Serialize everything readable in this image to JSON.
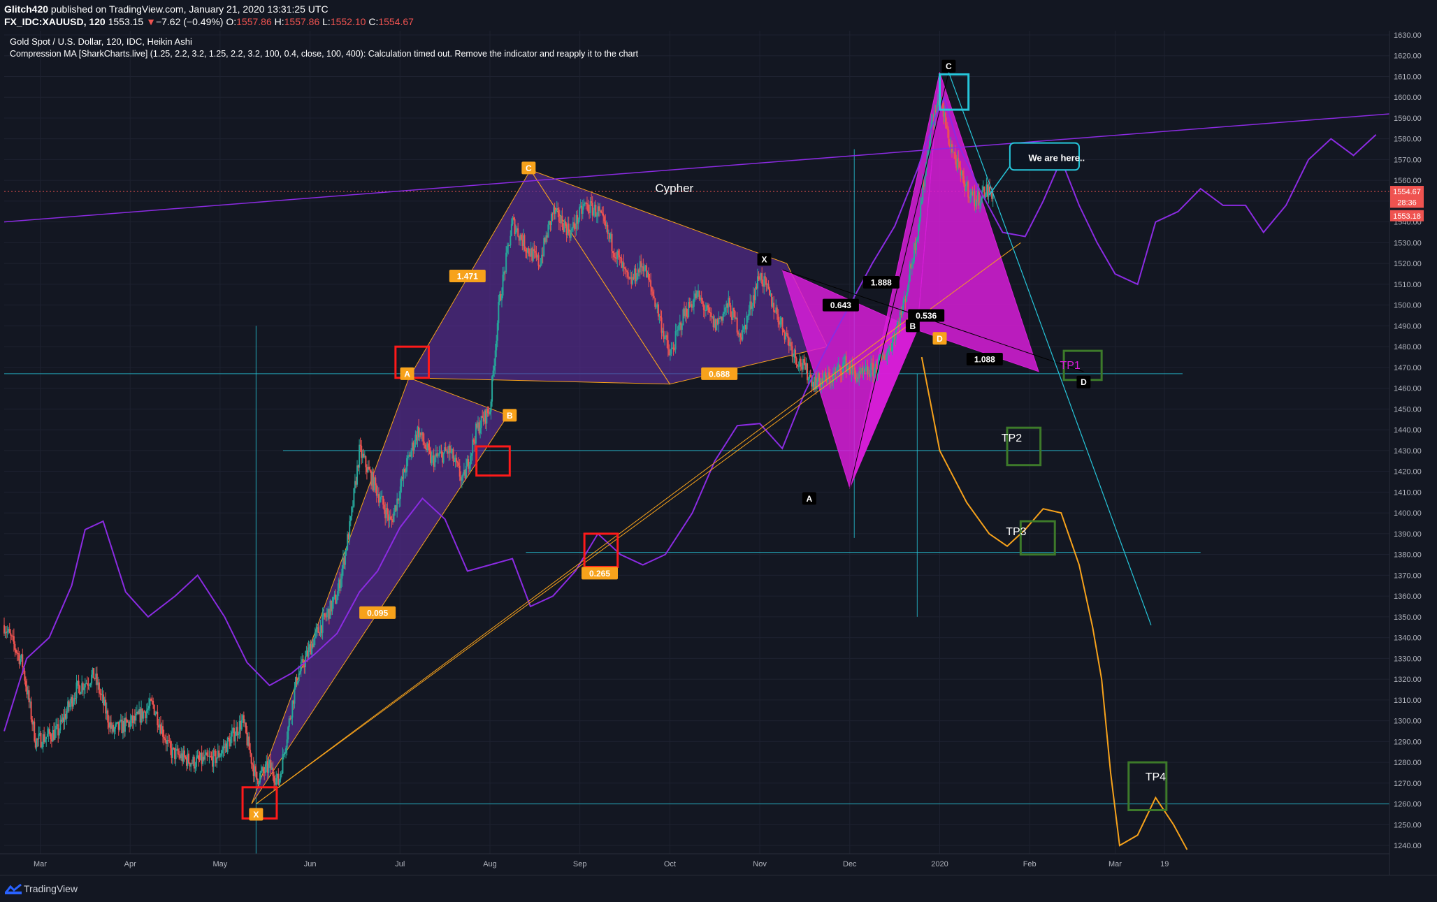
{
  "header": {
    "author": "Glitch420",
    "published": " published on TradingView.com, January 21, 2020 13:31:25 UTC",
    "symbol": "FX_IDC:XAUUSD, 120",
    "last": "1553.15",
    "arrow": "▼",
    "change": "−7.62 (−0.49%)",
    "o_label": "O:",
    "o": "1557.86",
    "h_label": "H:",
    "h": "1557.86",
    "l_label": "L:",
    "l": "1552.10",
    "c_label": "C:",
    "c": "1554.67"
  },
  "legend": {
    "title": "Gold Spot / U.S. Dollar, 120, IDC, Heikin Ashi",
    "indicator": "Compression MA [SharkCharts.live] (1.25, 2.2, 3.2, 1.25, 2.2, 3.2, 100, 0.4, close, 100, 400): Calculation timed out. Remove the indicator and reapply it to the chart"
  },
  "colors": {
    "background": "#131722",
    "grid": "#1e2230",
    "candle_up": "#26a69a",
    "candle_down": "#ef5350",
    "purple": "#8b2be2",
    "orange": "#f7a21b",
    "magenta": "#d81dd8",
    "cyan": "#26c6da",
    "red_box": "#ff1a1a",
    "green_box": "#3d7a2a"
  },
  "footer": {
    "brand": "TradingView"
  },
  "chart_data": {
    "type": "candlestick",
    "y_ticks": [
      1240,
      1250,
      1260,
      1270,
      1280,
      1290,
      1300,
      1310,
      1320,
      1330,
      1340,
      1350,
      1360,
      1370,
      1380,
      1390,
      1400,
      1410,
      1420,
      1430,
      1440,
      1450,
      1460,
      1470,
      1480,
      1490,
      1500,
      1510,
      1520,
      1530,
      1540,
      1550,
      1560,
      1570,
      1580,
      1590,
      1600,
      1610,
      1620,
      1630
    ],
    "ylim": [
      1236,
      1632
    ],
    "x_labels": [
      {
        "label": "Mar",
        "t": 0.5
      },
      {
        "label": "Apr",
        "t": 1.5
      },
      {
        "label": "May",
        "t": 2.5
      },
      {
        "label": "Jun",
        "t": 3.5
      },
      {
        "label": "Jul",
        "t": 4.5
      },
      {
        "label": "Aug",
        "t": 5.5
      },
      {
        "label": "Sep",
        "t": 6.5
      },
      {
        "label": "Oct",
        "t": 7.5
      },
      {
        "label": "Nov",
        "t": 8.5
      },
      {
        "label": "Dec",
        "t": 9.5
      },
      {
        "label": "2020",
        "t": 10.5
      },
      {
        "label": "Feb",
        "t": 11.5
      },
      {
        "label": "Mar",
        "t": 12.45
      },
      {
        "label": "19",
        "t": 13.0
      }
    ],
    "xlim": [
      0.1,
      15.5
    ],
    "price_labels": [
      {
        "value": 1554.67,
        "text": "1554.67",
        "color": "#ef5350"
      },
      {
        "value": 1549.5,
        "text": "28:36",
        "color": "#ef5350"
      },
      {
        "value": 1543.0,
        "text": "1553.18",
        "color": "#ef5350"
      }
    ],
    "current_price": 1554.67,
    "price_path": [
      [
        0.1,
        1346
      ],
      [
        0.3,
        1328
      ],
      [
        0.45,
        1290
      ],
      [
        0.7,
        1295
      ],
      [
        0.9,
        1315
      ],
      [
        1.1,
        1322
      ],
      [
        1.3,
        1295
      ],
      [
        1.55,
        1300
      ],
      [
        1.75,
        1308
      ],
      [
        1.95,
        1285
      ],
      [
        2.2,
        1280
      ],
      [
        2.45,
        1282
      ],
      [
        2.6,
        1290
      ],
      [
        2.75,
        1300
      ],
      [
        2.9,
        1272
      ],
      [
        3.05,
        1278
      ],
      [
        3.15,
        1270
      ],
      [
        3.35,
        1320
      ],
      [
        3.55,
        1340
      ],
      [
        3.8,
        1360
      ],
      [
        3.95,
        1395
      ],
      [
        4.05,
        1430
      ],
      [
        4.25,
        1410
      ],
      [
        4.4,
        1395
      ],
      [
        4.55,
        1420
      ],
      [
        4.7,
        1440
      ],
      [
        4.85,
        1425
      ],
      [
        5.05,
        1430
      ],
      [
        5.2,
        1415
      ],
      [
        5.35,
        1440
      ],
      [
        5.5,
        1450
      ],
      [
        5.6,
        1500
      ],
      [
        5.75,
        1540
      ],
      [
        5.9,
        1528
      ],
      [
        6.05,
        1520
      ],
      [
        6.2,
        1545
      ],
      [
        6.4,
        1535
      ],
      [
        6.55,
        1548
      ],
      [
        6.7,
        1545
      ],
      [
        6.85,
        1530
      ],
      [
        7.05,
        1510
      ],
      [
        7.2,
        1520
      ],
      [
        7.35,
        1500
      ],
      [
        7.5,
        1475
      ],
      [
        7.65,
        1495
      ],
      [
        7.8,
        1505
      ],
      [
        8.0,
        1490
      ],
      [
        8.15,
        1500
      ],
      [
        8.3,
        1485
      ],
      [
        8.5,
        1515
      ],
      [
        8.6,
        1505
      ],
      [
        8.75,
        1490
      ],
      [
        8.9,
        1475
      ],
      [
        9.1,
        1463
      ],
      [
        9.3,
        1465
      ],
      [
        9.45,
        1472
      ],
      [
        9.6,
        1465
      ],
      [
        9.8,
        1470
      ],
      [
        9.95,
        1480
      ],
      [
        10.1,
        1500
      ],
      [
        10.25,
        1535
      ],
      [
        10.4,
        1585
      ],
      [
        10.5,
        1600
      ],
      [
        10.6,
        1580
      ],
      [
        10.75,
        1560
      ],
      [
        10.9,
        1550
      ],
      [
        11.0,
        1555
      ],
      [
        11.1,
        1554
      ]
    ],
    "series": [
      {
        "name": "",
        "type": "line",
        "color": "#8b2be2",
        "points": [
          [
            0.1,
            1295
          ],
          [
            0.35,
            1330
          ],
          [
            0.6,
            1340
          ],
          [
            0.85,
            1365
          ],
          [
            1.0,
            1392
          ],
          [
            1.2,
            1396
          ],
          [
            1.45,
            1362
          ],
          [
            1.7,
            1350
          ],
          [
            2.0,
            1360
          ],
          [
            2.25,
            1370
          ],
          [
            2.55,
            1350
          ],
          [
            2.8,
            1328
          ],
          [
            3.05,
            1317
          ],
          [
            3.3,
            1323
          ],
          [
            3.55,
            1332
          ],
          [
            3.8,
            1342
          ],
          [
            4.05,
            1362
          ],
          [
            4.25,
            1372
          ],
          [
            4.5,
            1393
          ],
          [
            4.75,
            1407
          ],
          [
            5.0,
            1397
          ],
          [
            5.25,
            1372
          ],
          [
            5.5,
            1375
          ],
          [
            5.75,
            1378
          ],
          [
            5.95,
            1355
          ],
          [
            6.2,
            1360
          ],
          [
            6.45,
            1372
          ],
          [
            6.7,
            1390
          ],
          [
            6.95,
            1380
          ],
          [
            7.2,
            1375
          ],
          [
            7.45,
            1380
          ],
          [
            7.75,
            1400
          ],
          [
            8.0,
            1425
          ],
          [
            8.25,
            1442
          ],
          [
            8.5,
            1443
          ],
          [
            8.75,
            1431
          ],
          [
            9.0,
            1458
          ],
          [
            9.25,
            1480
          ],
          [
            9.5,
            1500
          ],
          [
            9.75,
            1520
          ],
          [
            10.0,
            1538
          ],
          [
            10.25,
            1565
          ],
          [
            10.45,
            1590
          ],
          [
            10.55,
            1600
          ],
          [
            10.7,
            1578
          ],
          [
            10.95,
            1555
          ],
          [
            11.2,
            1535
          ],
          [
            11.45,
            1533
          ],
          [
            11.65,
            1550
          ],
          [
            11.85,
            1570
          ],
          [
            12.05,
            1548
          ],
          [
            12.25,
            1530
          ],
          [
            12.45,
            1515
          ],
          [
            12.7,
            1510
          ],
          [
            12.9,
            1540
          ],
          [
            13.15,
            1545
          ],
          [
            13.4,
            1556
          ],
          [
            13.65,
            1548
          ],
          [
            13.9,
            1548
          ],
          [
            14.1,
            1535
          ],
          [
            14.35,
            1548
          ],
          [
            14.6,
            1570
          ],
          [
            14.85,
            1580
          ],
          [
            15.1,
            1572
          ],
          [
            15.35,
            1582
          ]
        ]
      },
      {
        "name": "",
        "type": "line",
        "color": "#f7a21b",
        "points": [
          [
            10.3,
            1475
          ],
          [
            10.5,
            1430
          ],
          [
            10.8,
            1405
          ],
          [
            11.05,
            1390
          ],
          [
            11.25,
            1384
          ],
          [
            11.45,
            1392
          ],
          [
            11.65,
            1402
          ],
          [
            11.85,
            1400
          ],
          [
            12.05,
            1375
          ],
          [
            12.2,
            1345
          ],
          [
            12.3,
            1320
          ],
          [
            12.4,
            1275
          ],
          [
            12.5,
            1240
          ],
          [
            12.7,
            1245
          ],
          [
            12.9,
            1263
          ],
          [
            13.1,
            1250
          ],
          [
            13.25,
            1238
          ]
        ]
      }
    ],
    "patterns": [
      {
        "name": "",
        "type": "polygon",
        "color": "#5a2d96",
        "points": [
          [
            2.85,
            1260
          ],
          [
            4.6,
            1465
          ],
          [
            5.7,
            1447
          ]
        ]
      },
      {
        "name": "",
        "type": "polygon",
        "color": "#5a2d96",
        "points": [
          [
            4.6,
            1465
          ],
          [
            5.95,
            1565
          ],
          [
            7.5,
            1462
          ]
        ]
      },
      {
        "name": "",
        "type": "polygon",
        "color": "#5a2d96",
        "points": [
          [
            5.95,
            1565
          ],
          [
            7.5,
            1462
          ],
          [
            9.25,
            1480
          ],
          [
            8.8,
            1520
          ]
        ]
      },
      {
        "name": "",
        "type": "polygon",
        "color": "#d81dd8",
        "points": [
          [
            8.75,
            1517
          ],
          [
            9.5,
            1412
          ],
          [
            10.25,
            1488
          ]
        ]
      },
      {
        "name": "",
        "type": "polygon",
        "color": "#d81dd8",
        "points": [
          [
            9.5,
            1412
          ],
          [
            10.25,
            1488
          ],
          [
            10.5,
            1612
          ]
        ]
      },
      {
        "name": "",
        "type": "polygon",
        "color": "#d81dd8",
        "points": [
          [
            10.25,
            1488
          ],
          [
            10.5,
            1612
          ],
          [
            11.6,
            1468
          ]
        ]
      }
    ],
    "labels": [
      {
        "text": "C",
        "t": 5.93,
        "value": 1566,
        "bg": "#f7a21b",
        "fg": "#ffffff"
      },
      {
        "text": "A",
        "t": 4.58,
        "value": 1467,
        "bg": "#f7a21b",
        "fg": "#ffffff"
      },
      {
        "text": "B",
        "t": 5.72,
        "value": 1447,
        "bg": "#f7a21b",
        "fg": "#ffffff"
      },
      {
        "text": "X",
        "t": 2.9,
        "value": 1255,
        "bg": "#f7a21b",
        "fg": "#ffffff"
      },
      {
        "text": "D",
        "t": 10.5,
        "value": 1484,
        "bg": "#f7a21b",
        "fg": "#ffffff"
      },
      {
        "text": "1.471",
        "t": 5.25,
        "value": 1514,
        "bg": "#f7a21b",
        "fg": "#ffffff"
      },
      {
        "text": "0.688",
        "t": 8.05,
        "value": 1467,
        "bg": "#f7a21b",
        "fg": "#ffffff"
      },
      {
        "text": "0.265",
        "t": 6.72,
        "value": 1371,
        "bg": "#f7a21b",
        "fg": "#ffffff"
      },
      {
        "text": "0.095",
        "t": 4.25,
        "value": 1352,
        "bg": "#f7a21b",
        "fg": "#ffffff"
      },
      {
        "text": "X",
        "t": 8.55,
        "value": 1522,
        "bg": "#000000",
        "fg": "#ffffff"
      },
      {
        "text": "C",
        "t": 10.6,
        "value": 1615,
        "bg": "#000000",
        "fg": "#ffffff"
      },
      {
        "text": "B",
        "t": 10.2,
        "value": 1490,
        "bg": "#000000",
        "fg": "#ffffff"
      },
      {
        "text": "A",
        "t": 9.05,
        "value": 1407,
        "bg": "#000000",
        "fg": "#ffffff"
      },
      {
        "text": "D",
        "t": 12.1,
        "value": 1463,
        "bg": "#000000",
        "fg": "#ffffff"
      },
      {
        "text": "1.888",
        "t": 9.85,
        "value": 1511,
        "bg": "#000000",
        "fg": "#ffffff"
      },
      {
        "text": "0.643",
        "t": 9.4,
        "value": 1500,
        "bg": "#000000",
        "fg": "#ffffff"
      },
      {
        "text": "0.536",
        "t": 10.35,
        "value": 1495,
        "bg": "#000000",
        "fg": "#ffffff"
      },
      {
        "text": "1.088",
        "t": 11.0,
        "value": 1474,
        "bg": "#000000",
        "fg": "#ffffff"
      }
    ],
    "annotations": [
      {
        "text": "Cypher",
        "t": 7.55,
        "value": 1556
      },
      {
        "text": "We are here..",
        "t": 11.8,
        "value": 1571
      },
      {
        "text": "TP1",
        "t": 11.95,
        "value": 1471
      },
      {
        "text": "TP2",
        "t": 11.3,
        "value": 1436
      },
      {
        "text": "TP3",
        "t": 11.35,
        "value": 1391
      },
      {
        "text": "TP4",
        "t": 12.9,
        "value": 1273
      }
    ]
  }
}
